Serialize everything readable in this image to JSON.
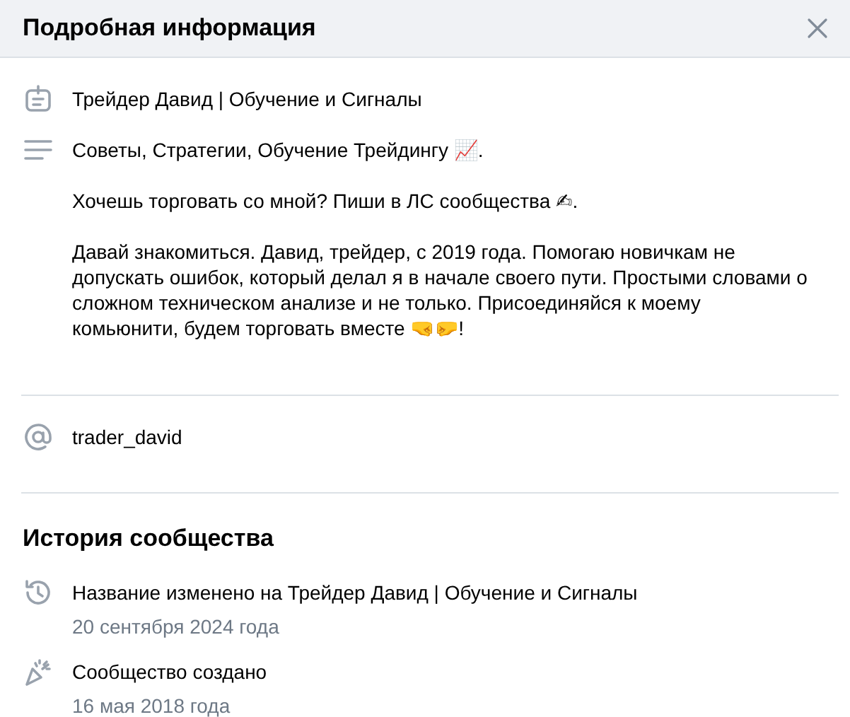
{
  "header": {
    "title": "Подробная информация"
  },
  "info": [
    {
      "kind": "name",
      "text": "Трейдер Давид | Обучение и Сигналы"
    },
    {
      "kind": "description",
      "paragraphs": [
        "Советы, Стратегии, Обучение Трейдингу 📈.",
        "Хочешь торговать со мной? Пиши в ЛС сообщества ✍.",
        "Давай знакомиться. Давид, трейдер, с 2019 года. Помогаю новичкам не допускать ошибок, который делал я в начале своего пути. Простыми словами о сложном техническом анализе и не только. Присоединяйся к моему комьюнити, будем торговать вместе 🤜🤛!"
      ]
    },
    {
      "kind": "username",
      "text": "trader_david"
    }
  ],
  "history": {
    "title": "История сообщества",
    "events": [
      {
        "kind": "renamed",
        "text": "Название изменено на Трейдер Давид | Обучение и Сигналы",
        "date": "20 сентября 2024 года"
      },
      {
        "kind": "created",
        "text": "Сообщество создано",
        "date": "16 мая 2018 года"
      }
    ]
  }
}
